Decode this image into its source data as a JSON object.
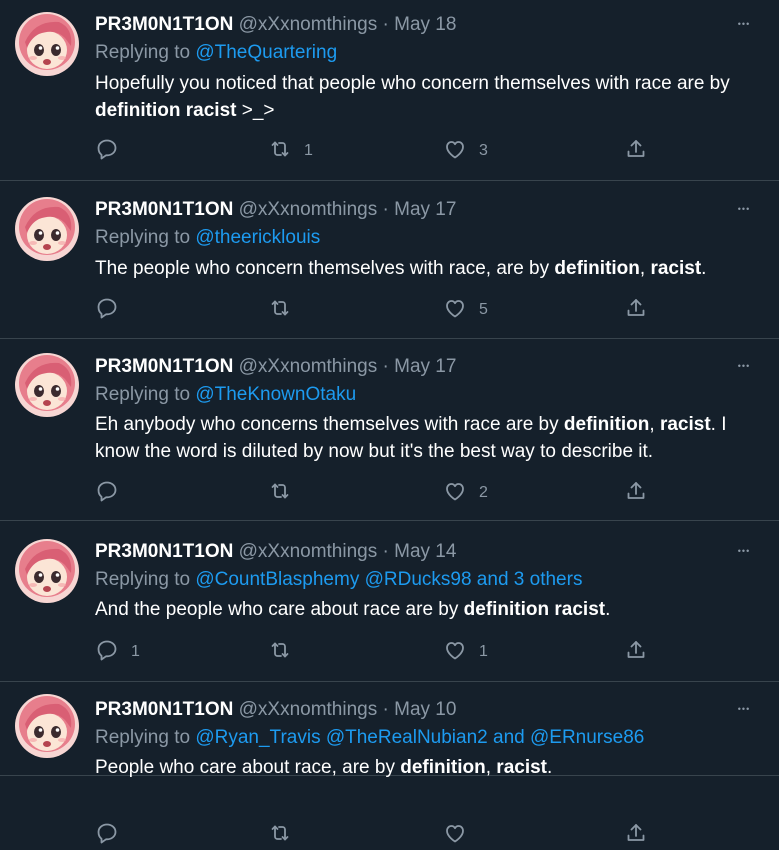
{
  "tweets": [
    {
      "name": "PR3M0N1T1ON",
      "handle": "@xXxnomthings",
      "dot": "·",
      "date": "May 18",
      "replying_prefix": "Replying to ",
      "replying_to": "@TheQuartering",
      "text": [
        "Hopefully you noticed that people who concern themselves with race are by ",
        {
          "b": "definition racist"
        },
        " >_>"
      ],
      "replies": "",
      "retweets": "1",
      "likes": "3"
    },
    {
      "name": "PR3M0N1T1ON",
      "handle": "@xXxnomthings",
      "dot": "·",
      "date": "May 17",
      "replying_prefix": "Replying to ",
      "replying_to": "@theericklouis",
      "text": [
        "The people who concern themselves with race, are by ",
        {
          "b": "definition"
        },
        ", ",
        {
          "b": "racist"
        },
        "."
      ],
      "replies": "",
      "retweets": "",
      "likes": "5"
    },
    {
      "name": "PR3M0N1T1ON",
      "handle": "@xXxnomthings",
      "dot": "·",
      "date": "May 17",
      "replying_prefix": "Replying to ",
      "replying_to": "@TheKnownOtaku",
      "text": [
        "Eh anybody who concerns themselves with race are by ",
        {
          "b": "definition"
        },
        ", ",
        {
          "b": "racist"
        },
        ". I know the word is diluted by now but it's the best way to describe it."
      ],
      "replies": "",
      "retweets": "",
      "likes": "2"
    },
    {
      "name": "PR3M0N1T1ON",
      "handle": "@xXxnomthings",
      "dot": "·",
      "date": "May 14",
      "replying_prefix": "Replying to ",
      "replying_to": "@CountBlasphemy @RDucks98 and 3 others",
      "text": [
        "And the people who care about race are by ",
        {
          "b": "definition racist"
        },
        "."
      ],
      "replies": "1",
      "retweets": "",
      "likes": "1"
    },
    {
      "name": "PR3M0N1T1ON",
      "handle": "@xXxnomthings",
      "dot": "·",
      "date": "May 10",
      "replying_prefix": "Replying to ",
      "replying_to": "@Ryan_Travis @TheRealNubian2 and @ERnurse86",
      "text": [
        "People who care about race, are by ",
        {
          "b": "definition"
        },
        ", ",
        {
          "b": "racist"
        },
        "."
      ],
      "replies": "",
      "retweets": "",
      "likes": ""
    }
  ],
  "icons": {
    "reply": "reply-icon",
    "retweet": "retweet-icon",
    "like": "heart-icon",
    "share": "share-icon",
    "more": "more-icon"
  },
  "colors": {
    "background": "#15202b",
    "divider": "#38444d",
    "secondary_text": "#8b98a5",
    "link": "#1d9bf0"
  }
}
